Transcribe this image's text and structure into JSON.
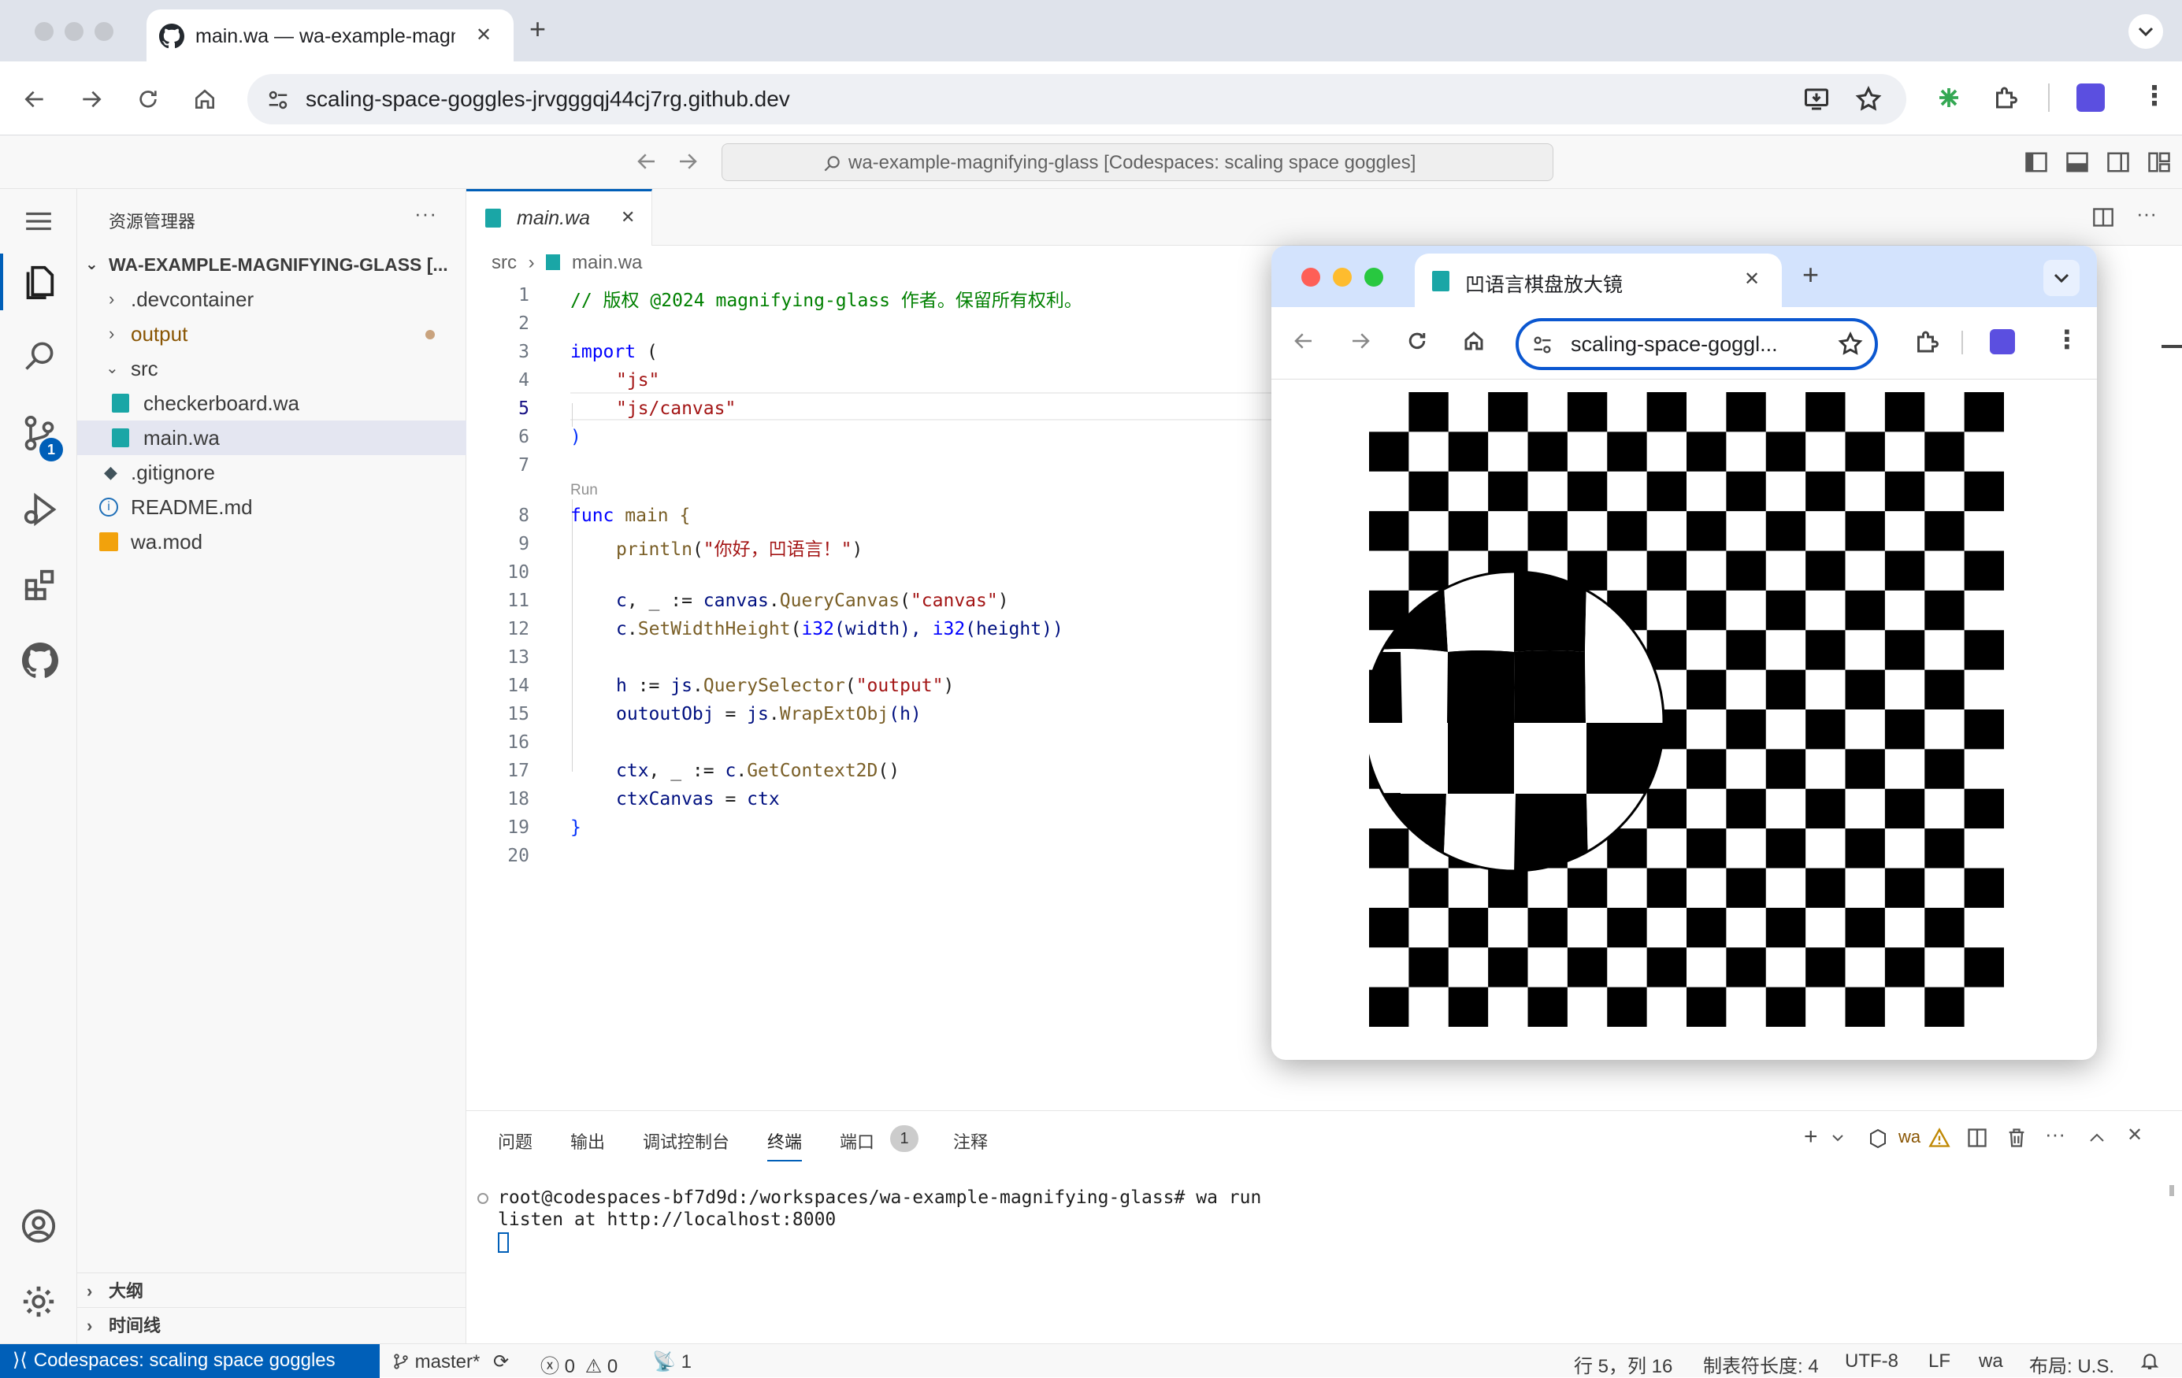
{
  "browser": {
    "tab_title": "main.wa — wa-example-magnifying-glass",
    "url": "scaling-space-goggles-jrvgggqj44cj7rg.github.dev",
    "new_tab": "+",
    "close": "✕"
  },
  "vscode": {
    "command_center": "wa-example-magnifying-glass [Codespaces: scaling space goggles]",
    "explorer_title": "资源管理器",
    "explorer_more": "···",
    "root_folder": "WA-EXAMPLE-MAGNIFYING-GLASS [...",
    "tree": [
      {
        "label": ".devcontainer",
        "type": "folder"
      },
      {
        "label": "output",
        "type": "folder"
      },
      {
        "label": "src",
        "type": "folder-open"
      },
      {
        "label": "checkerboard.wa",
        "type": "wa"
      },
      {
        "label": "main.wa",
        "type": "wa"
      },
      {
        "label": ".gitignore",
        "type": "git"
      },
      {
        "label": "README.md",
        "type": "info"
      },
      {
        "label": "wa.mod",
        "type": "mod"
      }
    ],
    "outline": "大纲",
    "timeline": "时间线",
    "scm_badge": "1",
    "editor_tab": "main.wa",
    "breadcrumb": [
      "src",
      "main.wa"
    ],
    "codelens_run": "Run",
    "line_numbers": [
      "1",
      "2",
      "3",
      "4",
      "5",
      "6",
      "7",
      "8",
      "9",
      "10",
      "11",
      "12",
      "13",
      "14",
      "15",
      "16",
      "17",
      "18",
      "19",
      "20"
    ],
    "code": {
      "l1": "// 版权 @2024 magnifying-glass 作者。保留所有权利。",
      "l3a": "import",
      "l3b": " (",
      "l4": "\"js\"",
      "l5": "\"js/canvas\"",
      "l6": ")",
      "l8a": "func",
      "l8b": " main {",
      "l9a": "println",
      "l9b": "(",
      "l9c": "\"你好，凹语言！\"",
      "l9d": ")",
      "l11a": "c",
      "l11b": ", _ := ",
      "l11c": "canvas",
      "l11d": ".",
      "l11e": "QueryCanvas",
      "l11f": "(",
      "l11g": "\"canvas\"",
      "l11h": ")",
      "l12a": "c",
      "l12b": ".",
      "l12c": "SetWidthHeight",
      "l12d": "(",
      "l12e": "i32",
      "l12f": "(width), ",
      "l12g": "i32",
      "l12h": "(height))",
      "l14a": "h",
      "l14b": " := ",
      "l14c": "js",
      "l14d": ".",
      "l14e": "QuerySelector",
      "l14f": "(",
      "l14g": "\"output\"",
      "l14h": ")",
      "l15a": "outoutObj",
      "l15b": " = ",
      "l15c": "js",
      "l15d": ".",
      "l15e": "WrapExtObj",
      "l15f": "(h)",
      "l17a": "ctx",
      "l17b": ", _ := ",
      "l17c": "c",
      "l17d": ".",
      "l17e": "GetContext2D",
      "l17f": "()",
      "l18a": "ctxCanvas",
      "l18b": " = ",
      "l18c": "ctx",
      "l19": "}"
    },
    "panel_tabs": [
      "问题",
      "输出",
      "调试控制台",
      "终端",
      "端口",
      "注释"
    ],
    "ports_badge": "1",
    "terminal_profile": "wa",
    "terminal": {
      "line1": "root@codespaces-bf7d9d:/workspaces/wa-example-magnifying-glass# wa run",
      "line2": "listen at http://localhost:8000"
    },
    "status": {
      "remote": "Codespaces: scaling space goggles",
      "branch": "master*",
      "errors": "0",
      "warnings": "0",
      "ports": "1",
      "position": "行 5，列 16",
      "indent": "制表符长度: 4",
      "encoding": "UTF-8",
      "eol": "LF",
      "language": "wa",
      "layout": "布局: U.S."
    }
  },
  "popup": {
    "tab_title": "凹语言棋盘放大镜",
    "url": "scaling-space-goggl...",
    "new_tab": "+",
    "close": "✕"
  }
}
